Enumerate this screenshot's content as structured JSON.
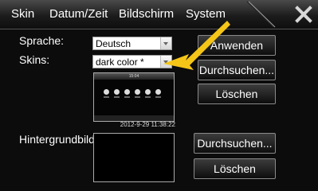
{
  "tabs": {
    "skin": "Skin",
    "datum_zeit": "Datum/Zeit",
    "bildschirm": "Bildschirm",
    "system": "System"
  },
  "icons": {
    "close": "close-x-icon"
  },
  "settings": {
    "sprache_label": "Sprache:",
    "sprache_value": "Deutsch",
    "skins_label": "Skins:",
    "skins_value": "dark color *",
    "hintergrund_label": "Hintergrundbild:"
  },
  "buttons": {
    "anwenden": "Anwenden",
    "durchsuchen_skin": "Durchsuchen...",
    "loeschen_skin": "Löschen",
    "durchsuchen_bg": "Durchsuchen...",
    "loeschen_bg": "Löschen"
  },
  "preview": {
    "clock": "15:04",
    "timestamp": "2012-9-29 11:38:22"
  },
  "colors": {
    "pointer_arrow": "#f5c518",
    "topbar": "#2a2a2a"
  }
}
